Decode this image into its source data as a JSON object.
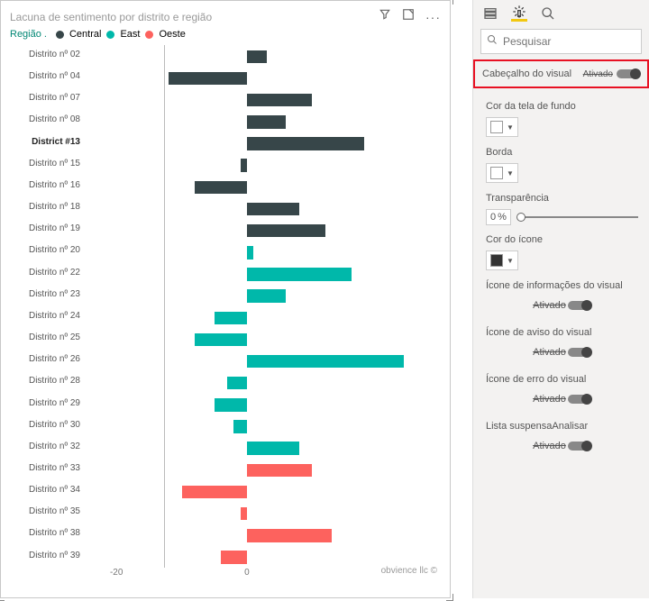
{
  "chart_data": {
    "type": "bar",
    "title": "Lacuna de sentimento por distrito e região",
    "xlabel": "",
    "ylabel": "",
    "xlim": [
      -25,
      30
    ],
    "legend_title": "Região .",
    "series_meta": [
      {
        "name": "Central",
        "color": "#374649"
      },
      {
        "name": "East",
        "color": "#00b8aa"
      },
      {
        "name": "Oeste",
        "color": "#fd625e"
      }
    ],
    "ticks": [
      -20,
      0
    ],
    "rows": [
      {
        "label": "Distrito nº 02",
        "region": "east",
        "value": 3,
        "bold": false
      },
      {
        "label": "Distrito nº 04",
        "region": "east",
        "value": -12,
        "bold": false
      },
      {
        "label": "Distrito nº 07",
        "region": "east",
        "value": 10,
        "bold": false
      },
      {
        "label": "Distrito nº 08",
        "region": "east",
        "value": 6,
        "bold": false
      },
      {
        "label": "District #13",
        "region": "east",
        "value": 18,
        "bold": true
      },
      {
        "label": "Distrito nº 15",
        "region": "east",
        "value": -1,
        "bold": false
      },
      {
        "label": "Distrito nº 16",
        "region": "east",
        "value": -8,
        "bold": false
      },
      {
        "label": "Distrito nº 18",
        "region": "east",
        "value": 8,
        "bold": false
      },
      {
        "label": "Distrito nº 19",
        "region": "east",
        "value": 12,
        "bold": false
      },
      {
        "label": "Distrito nº 20",
        "region": "central",
        "value": 1,
        "bold": false
      },
      {
        "label": "Distrito nº 22",
        "region": "central",
        "value": 16,
        "bold": false
      },
      {
        "label": "Distrito nº 23",
        "region": "central",
        "value": 6,
        "bold": false
      },
      {
        "label": "Distrito nº 24",
        "region": "central",
        "value": -5,
        "bold": false
      },
      {
        "label": "Distrito nº 25",
        "region": "central",
        "value": -8,
        "bold": false
      },
      {
        "label": "Distrito nº 26",
        "region": "central",
        "value": 24,
        "bold": false
      },
      {
        "label": "Distrito nº 28",
        "region": "central",
        "value": -3,
        "bold": false
      },
      {
        "label": "Distrito nº 29",
        "region": "central",
        "value": -5,
        "bold": false
      },
      {
        "label": "Distrito nº 30",
        "region": "central",
        "value": -2,
        "bold": false
      },
      {
        "label": "Distrito nº 32",
        "region": "central",
        "value": 8,
        "bold": false
      },
      {
        "label": "Distrito nº 33",
        "region": "oeste",
        "value": 10,
        "bold": false
      },
      {
        "label": "Distrito nº 34",
        "region": "oeste",
        "value": -10,
        "bold": false
      },
      {
        "label": "Distrito nº 35",
        "region": "oeste",
        "value": -1,
        "bold": false
      },
      {
        "label": "Distrito nº 38",
        "region": "oeste",
        "value": 13,
        "bold": false
      },
      {
        "label": "Distrito nº 39",
        "region": "oeste",
        "value": -4,
        "bold": false
      }
    ],
    "attribution": "obvience llc  ©"
  },
  "header_icons": {
    "filter": "filter-icon",
    "focus": "focus-icon",
    "more": "more-icon"
  },
  "format": {
    "search_placeholder": "Pesquisar",
    "visual_header": {
      "label": "Cabeçalho do visual",
      "state": "Ativado"
    },
    "bg_color_label": "Cor da tela de fundo",
    "bg_color_value": "#ffffff",
    "border_label": "Borda",
    "border_value": "#ffffff",
    "transparency_label": "Transparência",
    "transparency_value": "0",
    "transparency_unit": "%",
    "icon_color_label": "Cor do ícone",
    "icon_color_value": "#333333",
    "info_icon_label": "Ícone de informações do visual",
    "info_icon_state": "Ativado",
    "warn_icon_label": "Ícone de aviso do visual",
    "warn_icon_state": "Ativado",
    "err_icon_label": "Ícone de erro do visual",
    "err_icon_state": "Ativado",
    "analyze_dd_label": "Lista suspensaAnalisar",
    "analyze_dd_state": "Ativado"
  }
}
